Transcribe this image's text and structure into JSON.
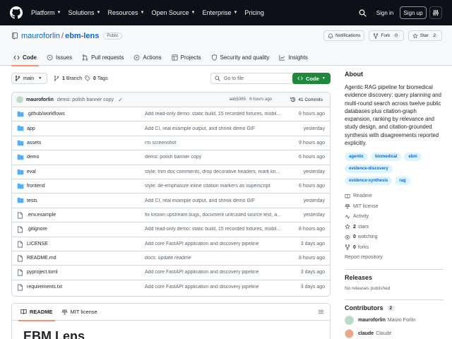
{
  "topnav": {
    "items": [
      "Platform",
      "Solutions",
      "Resources",
      "Open Source",
      "Enterprise",
      "Pricing"
    ]
  },
  "auth": {
    "signin": "Sign in",
    "signup": "Sign up"
  },
  "repo": {
    "owner": "mauroforlin",
    "name": "ebm-lens",
    "visibility": "Public",
    "notifications_label": "Notifications",
    "fork_label": "Fork",
    "fork_count": "0",
    "star_label": "Star",
    "star_count": "2"
  },
  "tabs": [
    "Code",
    "Issues",
    "Pull requests",
    "Actions",
    "Projects",
    "Security and quality",
    "Insights"
  ],
  "branchbar": {
    "branch": "main",
    "branches_count": "1",
    "branches_label": "Branch",
    "tags_count": "0",
    "tags_label": "Tags",
    "goto_placeholder": "Go to file",
    "code_label": "Code"
  },
  "commit": {
    "author": "mauroforlin",
    "message": "demo: polish banner copy",
    "meta": "aeb5365 · 6 hours ago",
    "commits_label": "41 Commits"
  },
  "files": [
    {
      "type": "dir",
      "name": ".github/workflows",
      "message": "Add read-only demo: static build, 15 recorded fixtures, mobil...",
      "date": "8 hours ago"
    },
    {
      "type": "dir",
      "name": "app",
      "message": "Add CI, real example output, and shrink demo GIF",
      "date": "yesterday"
    },
    {
      "type": "dir",
      "name": "assets",
      "message": "rm screenshot",
      "date": "9 hours ago"
    },
    {
      "type": "dir",
      "name": "demo",
      "message": "demo: polish banner copy",
      "date": "6 hours ago"
    },
    {
      "type": "dir",
      "name": "eval",
      "message": "style: trim doc comments, drop decorative headers, mark kn...",
      "date": "yesterday"
    },
    {
      "type": "dir",
      "name": "frontend",
      "message": "style: de-emphasize inline citation markers as superscript",
      "date": "6 hours ago"
    },
    {
      "type": "dir",
      "name": "tests",
      "message": "Add CI, real example output, and shrink demo GIF",
      "date": "yesterday"
    },
    {
      "type": "file",
      "name": ".env.example",
      "message": "fix known upstream bugs, document untrusted source text, a...",
      "date": "yesterday"
    },
    {
      "type": "file",
      "name": ".gitignore",
      "message": "Add read-only demo: static build, 15 recorded fixtures, mobil...",
      "date": "8 hours ago"
    },
    {
      "type": "file",
      "name": "LICENSE",
      "message": "Add core FastAPI application and discovery pipeline",
      "date": "3 days ago"
    },
    {
      "type": "file",
      "name": "README.md",
      "message": "docs: update readme",
      "date": "8 hours ago"
    },
    {
      "type": "file",
      "name": "pyproject.toml",
      "message": "Add core FastAPI application and discovery pipeline",
      "date": "3 days ago"
    },
    {
      "type": "file",
      "name": "requirements.txt",
      "message": "Add core FastAPI application and discovery pipeline",
      "date": "3 days ago"
    }
  ],
  "readme": {
    "tab_readme": "README",
    "tab_license": "MIT license",
    "heading": "EBM Lens"
  },
  "about": {
    "title": "About",
    "description": "Agentic RAG pipeline for biomedical evidence discovery: query planning and multi-round search across twelve public databases plus citation-graph expansion, ranking by relevance and study design, and citation-grounded synthesis with disagreements reported explicitly.",
    "topics": [
      "agentic",
      "biomedical",
      "ebm",
      "evidence-discovery",
      "evidence-synthesis",
      "rag"
    ],
    "readme_label": "Readme",
    "license_label": "MIT license",
    "activity_label": "Activity",
    "stars_count": "2",
    "stars_label": "stars",
    "watching_count": "0",
    "watching_label": "watching",
    "forks_count": "0",
    "forks_label": "forks",
    "report_label": "Report repository"
  },
  "releases": {
    "title": "Releases",
    "none": "No releases published"
  },
  "contributors": {
    "title": "Contributors",
    "count": "2",
    "people": [
      {
        "login": "mauroforlin",
        "name": "Mauro Forlin",
        "color": "#b7dcc3"
      },
      {
        "login": "claude",
        "name": "Claude",
        "color": "#f0a584"
      }
    ]
  },
  "colors": {
    "header_bg": "#0d1117",
    "link": "#0969da",
    "code_button": "#1f883d",
    "tab_underline": "#fd8c73",
    "folder_icon": "#54aeff",
    "topic_bg": "#ddf4ff"
  }
}
